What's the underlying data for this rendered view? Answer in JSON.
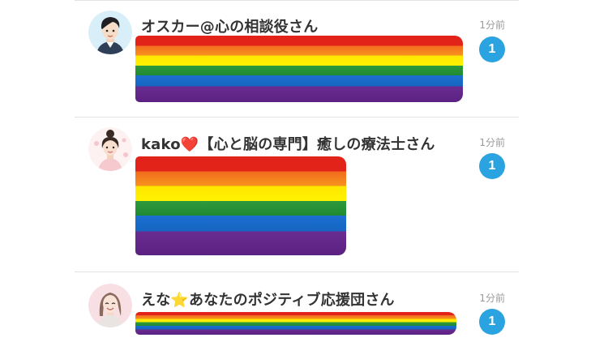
{
  "messages": [
    {
      "name": "オスカー@心の相談役さん",
      "emoji": "",
      "name_suffix": "",
      "time": "1分前",
      "unread": "1",
      "avatar": "man-avatar-icon"
    },
    {
      "name": "kako",
      "emoji": "❤️",
      "name_suffix": "【心と脳の専門】癒しの療法士さん",
      "time": "1分前",
      "unread": "1",
      "avatar": "woman-bun-avatar-icon"
    },
    {
      "name": "えな",
      "emoji": "⭐",
      "name_suffix": "あなたのポジティブ応援団さん",
      "time": "1分前",
      "unread": "1",
      "avatar": "woman-smiling-avatar-icon"
    }
  ],
  "colors": {
    "badge": "#2aa3e0",
    "divider": "#e3e3e3",
    "name_text": "#333333",
    "time_text": "#9a9a9a"
  }
}
